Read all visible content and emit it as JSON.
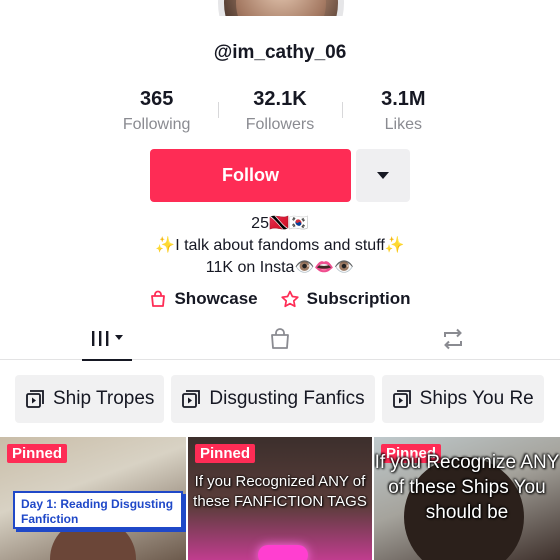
{
  "profile": {
    "username": "@im_cathy_06",
    "stats": [
      {
        "value": "365",
        "label": "Following"
      },
      {
        "value": "32.1K",
        "label": "Followers"
      },
      {
        "value": "3.1M",
        "label": "Likes"
      }
    ],
    "follow_label": "Follow",
    "bio": [
      "25🇹🇹🇰🇷",
      "✨I talk about fandoms and stuff✨",
      "11K on Insta👁️👄👁️"
    ],
    "links": {
      "showcase": "Showcase",
      "subscription": "Subscription"
    }
  },
  "colors": {
    "accent": "#fe2c55",
    "text": "#161823",
    "muted": "#8a8b91"
  },
  "tabs": [
    {
      "icon": "videos-grid-icon",
      "active": true
    },
    {
      "icon": "shopping-bag-icon",
      "active": false
    },
    {
      "icon": "repost-icon",
      "active": false
    }
  ],
  "playlists": [
    "Ship Tropes",
    "Disgusting Fanfics",
    "Ships You Re"
  ],
  "videos": [
    {
      "badge": "Pinned",
      "caption": "Day 1: Reading Disgusting Fanfiction"
    },
    {
      "badge": "Pinned",
      "caption": "If you Recognized ANY of these FANFICTION TAGS"
    },
    {
      "badge": "Pinned",
      "caption": "If you Recognize ANY of these Ships You should be"
    }
  ]
}
